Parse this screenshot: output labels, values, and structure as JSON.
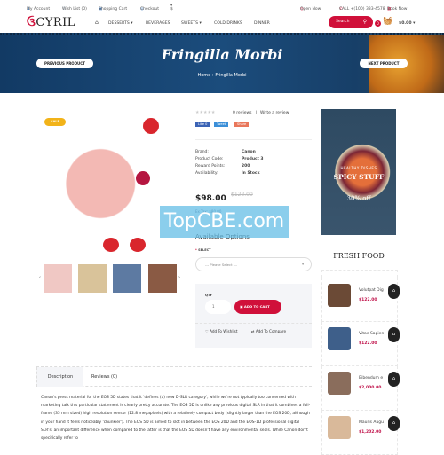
{
  "topbar": {
    "my_account": "My Account",
    "wishlist": "Wish List (0)",
    "cart": "Shopping Cart",
    "checkout": "Checkout",
    "currency": "$",
    "open": "Open Now",
    "call": "CALL +(100) 333-4578",
    "book": "Book Now"
  },
  "nav": {
    "logo": "CYRIL",
    "items": [
      "DESSERTS",
      "BEVERAGES",
      "SWEETS",
      "COLD DRINKS",
      "DINNER"
    ],
    "search": "Search",
    "cart_count": "0",
    "cart_total": "$0.00"
  },
  "banner": {
    "title": "Fringilla Morbi",
    "breadcrumb": [
      "Home",
      "Fringilla Morbi"
    ],
    "prev": "PREVIOUS PRODUCT",
    "next": "NEXT PRODUCT"
  },
  "product": {
    "sale": "SALE",
    "reviews": "0 reviews",
    "write_review": "Write a review",
    "rating": 0,
    "social": [
      "Like 0",
      "Tweet",
      "Share"
    ],
    "specs": [
      {
        "k": "Brand:",
        "v": "Canon"
      },
      {
        "k": "Product Code:",
        "v": "Product 3"
      },
      {
        "k": "Reward Points:",
        "v": "200"
      },
      {
        "k": "Availability:",
        "v": "In Stock"
      }
    ],
    "price": "$98.00",
    "old_price": "$122.00",
    "ex_tax": "Ex Tax: $80.00",
    "options_title": "Available Options",
    "select_label": "SELECT",
    "select_placeholder": "--- Please Select ---",
    "qty_label": "QTY",
    "qty": "1",
    "add_to_cart": "ADD TO CART",
    "wishlist": "Add To Wishlist",
    "compare": "Add To Compare"
  },
  "ad": {
    "small": "HEALTHY DISHES",
    "big": "SPICY STUFF",
    "off": "30% off"
  },
  "sidebar": {
    "title": "FRESH FOOD",
    "items": [
      {
        "name": "Volutpat Dig",
        "price": "$122.00"
      },
      {
        "name": "Vitae Sapien",
        "price": "$122.00"
      },
      {
        "name": "Bibendum e",
        "price": "$2,000.00"
      },
      {
        "name": "Mauris Augu",
        "price": "$1,202.00"
      }
    ]
  },
  "tabs": [
    "Description",
    "Reviews (0)"
  ],
  "description": "Canon's press material for the EOS 5D states that it 'defines (a) new D-SLR category', while we're not typically too concerned with marketing talk this particular statement is clearly pretty accurate. The EOS 5D is unlike any previous digital SLR in that it combines a full-frame (35 mm sized) high resolution sensor (12.8 megapixels) with a relatively compact body (slightly larger than the EOS 20D, although in your hand it feels noticeably 'chunkier'). The EOS 5D is aimed to slot in between the EOS 20D and the EOS-1D professional digital SLR's, an important difference when compared to the latter is that the EOS 5D doesn't have any environmental seals. While Canon don't specifically refer to",
  "watermark": "TopCBE.com",
  "colors": {
    "accent": "#d0103a",
    "banner": "#173f68",
    "sale": "#f2b319"
  }
}
